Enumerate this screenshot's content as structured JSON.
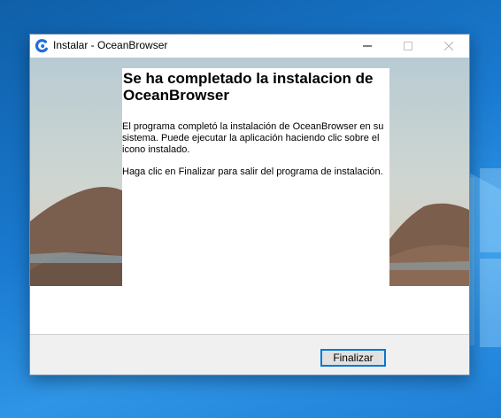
{
  "window": {
    "title": "Instalar - OceanBrowser"
  },
  "panel": {
    "title": "Se ha completado la instalacion de OceanBrowser",
    "paragraph1": "El programa completó la instalación de OceanBrowser en su sistema. Puede ejecutar la aplicación haciendo clic sobre el icono instalado.",
    "paragraph2": "Haga clic en Finalizar para salir del programa de instalación."
  },
  "footer": {
    "finish_label": "Finalizar"
  },
  "colors": {
    "accent": "#0078d7",
    "desktop": "#1a7ad0",
    "footer_bg": "#f0f0f0"
  },
  "icons": {
    "app": "oceanbrowser-logo-icon",
    "minimize": "minimize-icon",
    "maximize": "maximize-icon",
    "close": "close-icon"
  }
}
